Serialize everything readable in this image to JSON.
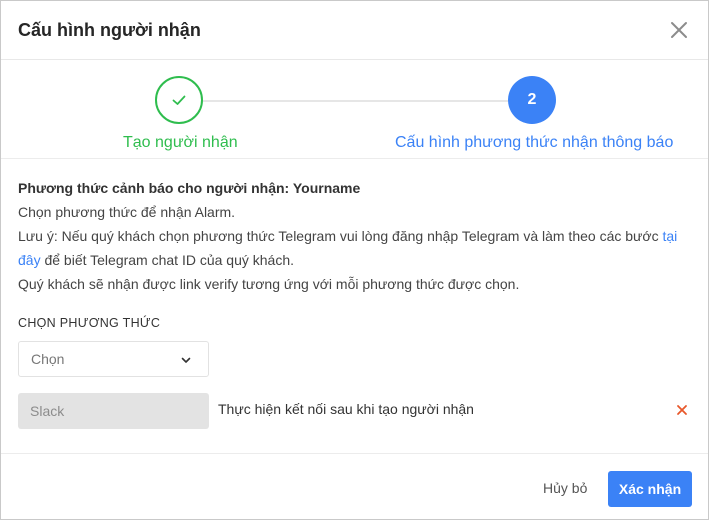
{
  "modal": {
    "title": "Cấu hình người nhận"
  },
  "steps": [
    {
      "label": "Tạo người nhận",
      "state": "completed",
      "icon": "check-icon",
      "color": "#2fbd4e"
    },
    {
      "label": "Cấu hình phương thức nhận thông báo",
      "number": "2",
      "state": "active",
      "color": "#3b82f6"
    }
  ],
  "intro": {
    "title": "Phương thức cảnh báo cho người nhận: Yourname",
    "line1": "Chọn phương thức để nhận Alarm.",
    "note_prefix": "Lưu ý: Nếu quý khách chọn phương thức Telegram vui lòng đăng nhập Telegram và làm theo các bước ",
    "note_link": "tại đây",
    "note_suffix": " để biết Telegram chat ID của quý khách.",
    "line3": "Quý khách sẽ nhận được link verify tương ứng với mỗi phương thức được chọn."
  },
  "method_section": {
    "label": "CHỌN PHƯƠNG THỨC",
    "select_value": "Chọn"
  },
  "methods": [
    {
      "name": "Slack",
      "note": "Thực hiện kết nối sau khi tạo người nhận"
    }
  ],
  "footer": {
    "cancel_label": "Hủy bỏ",
    "confirm_label": "Xác nhận"
  },
  "colors": {
    "primary": "#3b82f6",
    "success": "#2fbd4e",
    "danger": "#e8572a"
  }
}
